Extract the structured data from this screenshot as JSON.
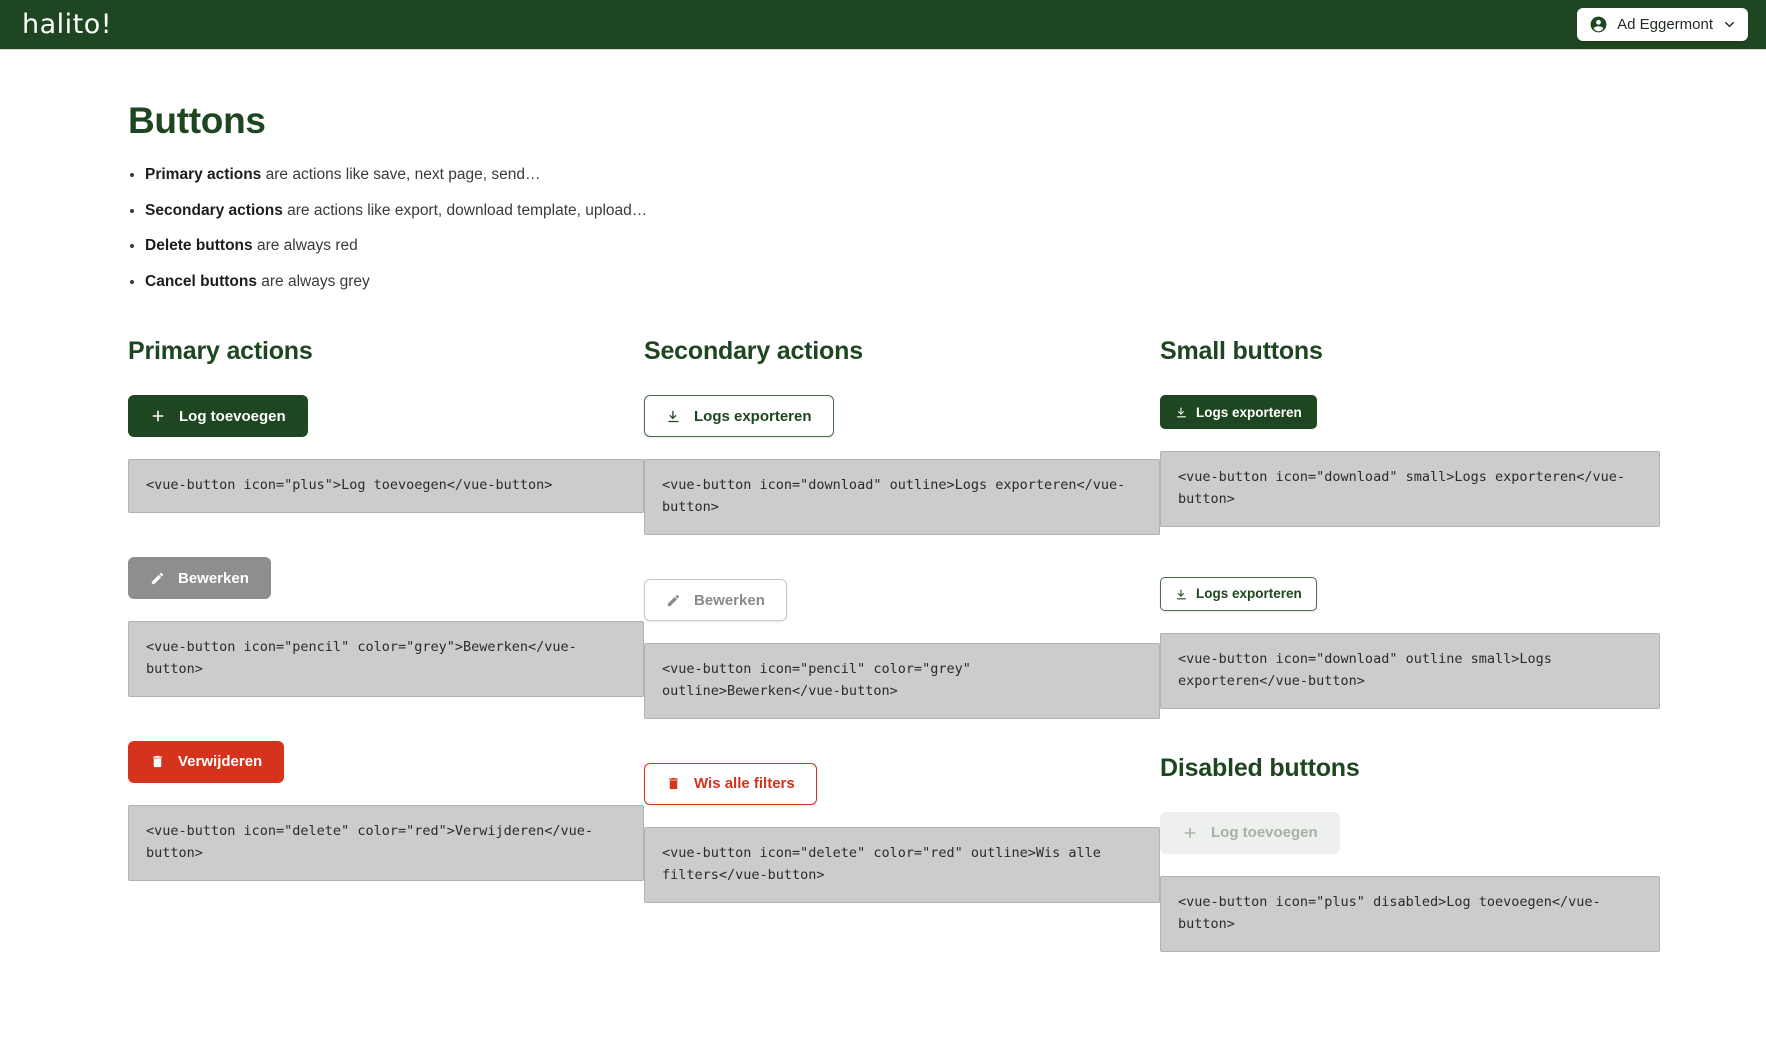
{
  "header": {
    "logo_text": "halito!",
    "user_name": "Ad Eggermont",
    "account_icon": "account-circle-icon",
    "chevron_icon": "chevron-down-icon",
    "bg_color": "#1e4620"
  },
  "page": {
    "title": "Buttons",
    "intro": [
      {
        "bold": "Primary actions",
        "rest": " are actions like save, next page, send…"
      },
      {
        "bold": "Secondary actions",
        "rest": " are actions like export, download template, upload…"
      },
      {
        "bold": "Delete buttons",
        "rest": " are always red"
      },
      {
        "bold": "Cancel buttons",
        "rest": " are always grey"
      }
    ]
  },
  "colors": {
    "green": "#1e4620",
    "red": "#d6331c",
    "grey": "#8e8e8e",
    "code_bg": "#cccccc"
  },
  "columns": {
    "primary": {
      "title": "Primary actions",
      "items": [
        {
          "button_label": "Log toevoegen",
          "icon": "plus-icon",
          "code": "<vue-button icon=\"plus\">Log toevoegen</vue-button>"
        },
        {
          "button_label": "Bewerken",
          "icon": "pencil-icon",
          "code": "<vue-button icon=\"pencil\" color=\"grey\">Bewerken</vue-button>"
        },
        {
          "button_label": "Verwijderen",
          "icon": "delete-icon",
          "code": "<vue-button icon=\"delete\" color=\"red\">Verwijderen</vue-button>"
        }
      ]
    },
    "secondary": {
      "title": "Secondary actions",
      "items": [
        {
          "button_label": "Logs exporteren",
          "icon": "download-icon",
          "code": "<vue-button icon=\"download\" outline>Logs exporteren</vue-button>"
        },
        {
          "button_label": "Bewerken",
          "icon": "pencil-icon",
          "code": "<vue-button icon=\"pencil\" color=\"grey\" outline>Bewerken</vue-button>"
        },
        {
          "button_label": "Wis alle filters",
          "icon": "delete-icon",
          "code": "<vue-button icon=\"delete\" color=\"red\" outline>Wis alle filters</vue-button>"
        }
      ]
    },
    "small": {
      "title": "Small buttons",
      "items": [
        {
          "button_label": "Logs exporteren",
          "icon": "download-icon",
          "code": "<vue-button icon=\"download\" small>Logs exporteren</vue-button>"
        },
        {
          "button_label": "Logs exporteren",
          "icon": "download-icon",
          "code": "<vue-button icon=\"download\" outline small>Logs exporteren</vue-button>"
        }
      ]
    },
    "disabled": {
      "title": "Disabled buttons",
      "items": [
        {
          "button_label": "Log toevoegen",
          "icon": "plus-icon",
          "code": "<vue-button icon=\"plus\" disabled>Log toevoegen</vue-button>"
        }
      ]
    }
  }
}
